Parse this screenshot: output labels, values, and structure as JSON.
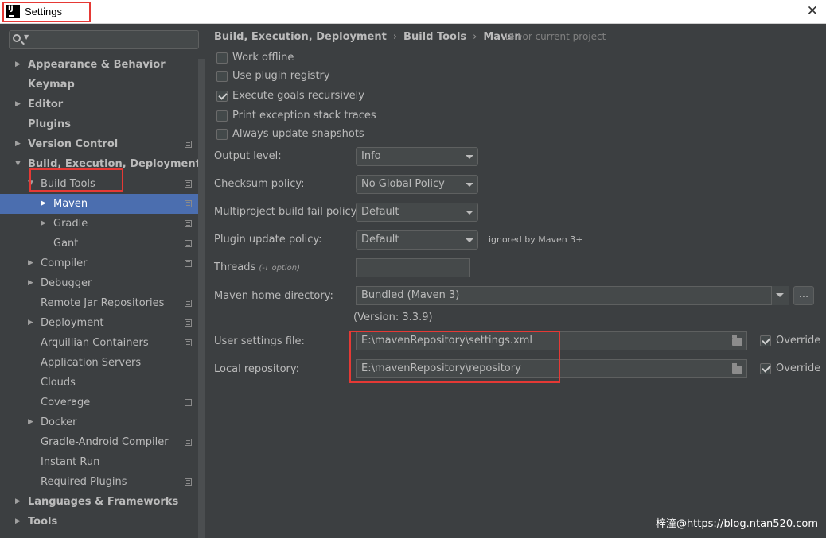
{
  "window": {
    "title": "Settings",
    "close_glyph": "✕"
  },
  "sidebar": {
    "search_placeholder": "",
    "items": [
      {
        "label": "Appearance & Behavior",
        "bold": true,
        "arrow": "▶",
        "indent": 0,
        "project_icon": false
      },
      {
        "label": "Keymap",
        "bold": true,
        "arrow": "",
        "indent": 0,
        "project_icon": false
      },
      {
        "label": "Editor",
        "bold": true,
        "arrow": "▶",
        "indent": 0,
        "project_icon": false
      },
      {
        "label": "Plugins",
        "bold": true,
        "arrow": "",
        "indent": 0,
        "project_icon": false
      },
      {
        "label": "Version Control",
        "bold": true,
        "arrow": "▶",
        "indent": 0,
        "project_icon": true
      },
      {
        "label": "Build, Execution, Deployment",
        "bold": true,
        "arrow": "▼",
        "indent": 0,
        "project_icon": false
      },
      {
        "label": "Build Tools",
        "bold": false,
        "arrow": "▼",
        "indent": 1,
        "project_icon": true
      },
      {
        "label": "Maven",
        "bold": false,
        "arrow": "▶",
        "indent": 2,
        "project_icon": true,
        "selected": true
      },
      {
        "label": "Gradle",
        "bold": false,
        "arrow": "▶",
        "indent": 2,
        "project_icon": true
      },
      {
        "label": "Gant",
        "bold": false,
        "arrow": "",
        "indent": 2,
        "project_icon": true
      },
      {
        "label": "Compiler",
        "bold": false,
        "arrow": "▶",
        "indent": 1,
        "project_icon": true
      },
      {
        "label": "Debugger",
        "bold": false,
        "arrow": "▶",
        "indent": 1,
        "project_icon": false
      },
      {
        "label": "Remote Jar Repositories",
        "bold": false,
        "arrow": "",
        "indent": 1,
        "project_icon": true
      },
      {
        "label": "Deployment",
        "bold": false,
        "arrow": "▶",
        "indent": 1,
        "project_icon": true
      },
      {
        "label": "Arquillian Containers",
        "bold": false,
        "arrow": "",
        "indent": 1,
        "project_icon": true
      },
      {
        "label": "Application Servers",
        "bold": false,
        "arrow": "",
        "indent": 1,
        "project_icon": false
      },
      {
        "label": "Clouds",
        "bold": false,
        "arrow": "",
        "indent": 1,
        "project_icon": false
      },
      {
        "label": "Coverage",
        "bold": false,
        "arrow": "",
        "indent": 1,
        "project_icon": true
      },
      {
        "label": "Docker",
        "bold": false,
        "arrow": "▶",
        "indent": 1,
        "project_icon": false
      },
      {
        "label": "Gradle-Android Compiler",
        "bold": false,
        "arrow": "",
        "indent": 1,
        "project_icon": true
      },
      {
        "label": "Instant Run",
        "bold": false,
        "arrow": "",
        "indent": 1,
        "project_icon": false
      },
      {
        "label": "Required Plugins",
        "bold": false,
        "arrow": "",
        "indent": 1,
        "project_icon": true
      },
      {
        "label": "Languages & Frameworks",
        "bold": true,
        "arrow": "▶",
        "indent": 0,
        "project_icon": false
      },
      {
        "label": "Tools",
        "bold": true,
        "arrow": "▶",
        "indent": 0,
        "project_icon": false
      }
    ]
  },
  "breadcrumb": {
    "parts": [
      "Build, Execution, Deployment",
      "Build Tools",
      "Maven"
    ],
    "separator": "›",
    "note": "For current project"
  },
  "checkboxes": [
    {
      "label": "Work offline",
      "checked": false
    },
    {
      "label": "Use plugin registry",
      "checked": false
    },
    {
      "label": "Execute goals recursively",
      "checked": true
    },
    {
      "label": "Print exception stack traces",
      "checked": false
    },
    {
      "label": "Always update snapshots",
      "checked": false
    }
  ],
  "form": {
    "output_level": {
      "label": "Output level:",
      "value": "Info"
    },
    "checksum_policy": {
      "label": "Checksum policy:",
      "value": "No Global Policy"
    },
    "fail_policy": {
      "label": "Multiproject build fail policy:",
      "value": "Default"
    },
    "plugin_update": {
      "label": "Plugin update policy:",
      "value": "Default",
      "note": "ignored by Maven 3+"
    },
    "threads": {
      "label": "Threads",
      "hint": "(-T option)",
      "value": ""
    },
    "maven_home": {
      "label": "Maven home directory:",
      "value": "Bundled (Maven 3)",
      "browse_label": "..."
    },
    "version": "(Version: 3.3.9)",
    "user_settings": {
      "label": "User settings file:",
      "value": "E:\\mavenRepository\\settings.xml",
      "override_label": "Override",
      "override_checked": true
    },
    "local_repo": {
      "label": "Local repository:",
      "value": "E:\\mavenRepository\\repository",
      "override_label": "Override",
      "override_checked": true
    }
  },
  "watermark": "梓潼@https://blog.ntan520.com",
  "colors": {
    "background": "#3c3f41",
    "selection": "#4b6eaf",
    "highlight_box": "#e53935",
    "text": "#bbbbbb"
  }
}
